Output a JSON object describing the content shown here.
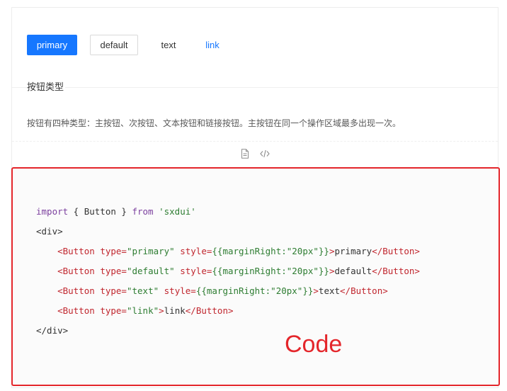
{
  "buttons": {
    "primary": "primary",
    "default": "default",
    "text": "text",
    "link": "link"
  },
  "meta": {
    "title": "按钮类型",
    "description": "按钮有四种类型：主按钮、次按钮、文本按钮和链接按钮。主按钮在同一个操作区域最多出现一次。"
  },
  "actions": [
    {
      "icon": "file-icon"
    },
    {
      "icon": "code-icon"
    }
  ],
  "code": {
    "line1": {
      "kw_import": "import",
      "p1": " { Button } ",
      "kw_from": "from",
      "p2": " ",
      "s1": "'sxdui'"
    },
    "line2": {
      "p": "<div>"
    },
    "line3": {
      "indent": "    ",
      "t1": "<Button",
      "p1": " ",
      "a1": "type=",
      "s1": "\"primary\"",
      "p2": " ",
      "a2": "style=",
      "s2": "{{marginRight:\"20px\"}}",
      "t2": ">",
      "p3": "primary",
      "t3": "</Button>"
    },
    "line4": {
      "indent": "    ",
      "t1": "<Button",
      "p1": " ",
      "a1": "type=",
      "s1": "\"default\"",
      "p2": " ",
      "a2": "style=",
      "s2": "{{marginRight:\"20px\"}}",
      "t2": ">",
      "p3": "default",
      "t3": "</Button>"
    },
    "line5": {
      "indent": "    ",
      "t1": "<Button",
      "p1": " ",
      "a1": "type=",
      "s1": "\"text\"",
      "p2": " ",
      "a2": "style=",
      "s2": "{{marginRight:\"20px\"}}",
      "t2": ">",
      "p3": "text",
      "t3": "</Button>"
    },
    "line6": {
      "indent": "    ",
      "t1": "<Button",
      "p1": " ",
      "a1": "type=",
      "s1": "\"link\"",
      "t2": ">",
      "p3": "link",
      "t3": "</Button>"
    },
    "line7": {
      "p": "</div>"
    }
  },
  "annotation": {
    "label": "Code"
  },
  "colors": {
    "primary": "#1677ff",
    "annotation_red": "#e4262b",
    "keyword": "#7b3f9e",
    "string": "#2e7d32",
    "tag": "#c0262e"
  }
}
